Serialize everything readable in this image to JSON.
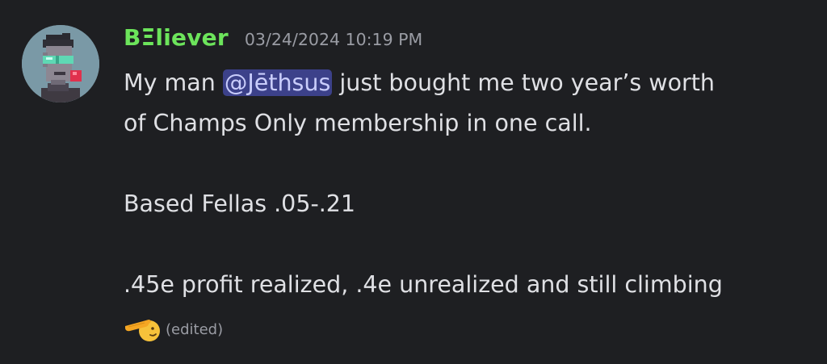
{
  "message": {
    "author": {
      "username": "BΞliever",
      "avatar_icon": "pixel-punk-avatar-icon",
      "name_color": "#6ce45b"
    },
    "timestamp": "03/24/2024 10:19 PM",
    "mention": "@Jēthsus",
    "line1_before": "My man ",
    "line1_after": " just bought me two year’s worth",
    "line2": "of Champs Only membership in one call.",
    "line3": "Based Fellas .05-.21",
    "line4": ".45e profit realized, .4e unrealized and still climbing",
    "emoji_icon": "saluting-face-emoji-icon",
    "edited_label": "(edited)"
  },
  "colors": {
    "background": "#1e1f22",
    "text": "#dfe0e4",
    "muted": "#9a9ca4",
    "mention_bg": "#3c418a",
    "mention_text": "#c9cdfb"
  }
}
